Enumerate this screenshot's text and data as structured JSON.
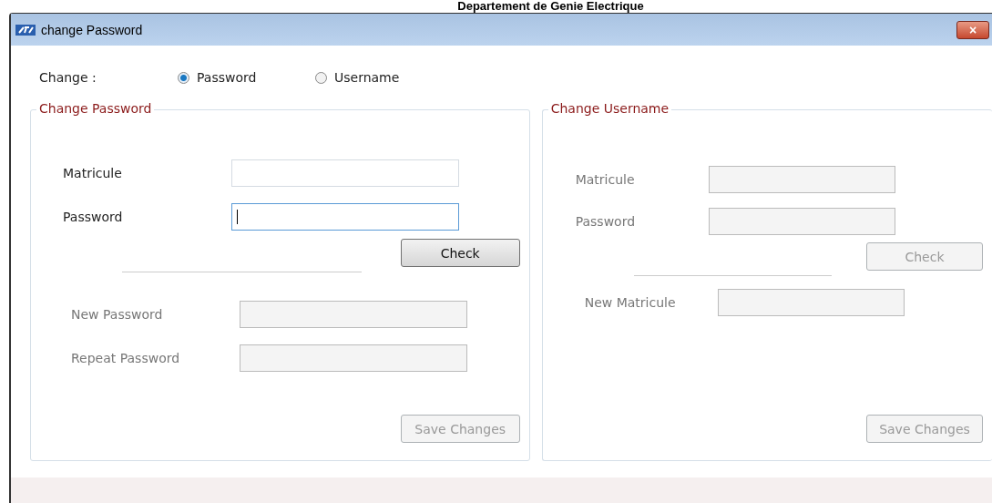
{
  "page_heading": "Departement de Genie Electrique",
  "window": {
    "title": "change Password",
    "close": "×"
  },
  "change_label": "Change :",
  "options": [
    {
      "label": "Password",
      "selected": true
    },
    {
      "label": "Username",
      "selected": false
    }
  ],
  "groups": [
    {
      "title": "Change Password",
      "fields": [
        {
          "label": "Matricule",
          "disabled": false,
          "focused": false
        },
        {
          "label": "Password",
          "disabled": false,
          "focused": true
        }
      ],
      "check": {
        "label": "Check",
        "disabled": false
      },
      "new_fields": [
        {
          "label": "New Password",
          "disabled": true,
          "focused": false
        },
        {
          "label": "Repeat Password",
          "disabled": true,
          "focused": false
        }
      ],
      "save": {
        "label": "Save Changes",
        "disabled": true
      }
    },
    {
      "title": "Change Username",
      "fields": [
        {
          "label": "Matricule",
          "disabled": true,
          "focused": false
        },
        {
          "label": "Password",
          "disabled": true,
          "focused": false
        }
      ],
      "check": {
        "label": "Check",
        "disabled": true
      },
      "new_fields": [
        {
          "label": "New Matricule",
          "disabled": true,
          "focused": false
        }
      ],
      "save": {
        "label": "Save Changes",
        "disabled": true
      }
    }
  ]
}
